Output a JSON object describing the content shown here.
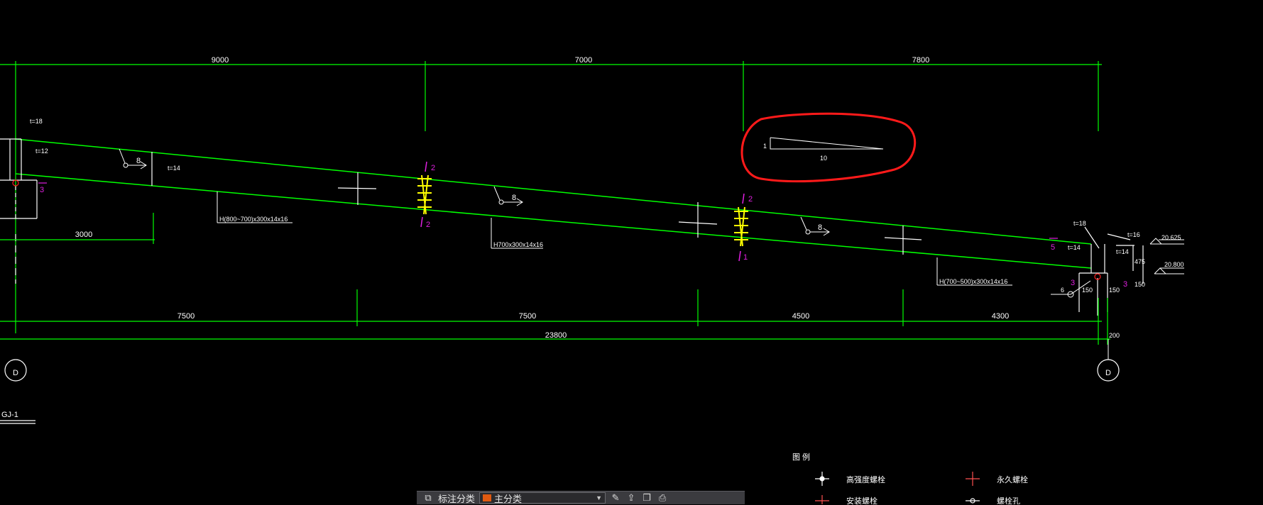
{
  "drawing": {
    "title": "GJ-1",
    "top_dimensions": [
      "9000",
      "7000",
      "7800"
    ],
    "bottom_dimensions": [
      "7500",
      "7500",
      "4500",
      "4300"
    ],
    "overall_dimension": "23800",
    "left_dimension": "3000",
    "right_offset": "200",
    "axis_left": "D",
    "axis_right": "D",
    "beam_labels": [
      "H(800~700)x300x14x16",
      "H700x300x14x16",
      "H(700~500)x300x14x16"
    ],
    "weld_sizes": [
      "8",
      "8",
      "8"
    ],
    "plate_labels": [
      "t=18",
      "t=12",
      "t=14",
      "t=18",
      "t=14",
      "t=16",
      "t=14"
    ],
    "splice_marks": [
      "2",
      "2",
      "2",
      "1"
    ],
    "section_marks": [
      "3",
      "5",
      "3",
      "3"
    ],
    "right_dims": [
      "150",
      "150",
      "475",
      "150"
    ],
    "elevations": [
      "20.625",
      "20.800"
    ],
    "slope_note": {
      "rise": "1",
      "run": "10"
    },
    "bolt_ref": "6"
  },
  "legend": {
    "title": "图 例",
    "items": [
      "高强度螺栓",
      "永久螺栓",
      "安装螺栓",
      "螺栓孔"
    ]
  },
  "toolbar": {
    "label": "标注分类",
    "select_value": "主分类",
    "icons": [
      "layers-icon",
      "edit-icon",
      "upload-icon",
      "copy-icon",
      "print-icon"
    ]
  },
  "colors": {
    "grid": "#00ff00",
    "lines": "#ffffff",
    "bolts": "#ffff00",
    "marks": "#e020e0",
    "annotation": "#ff2020",
    "background": "#000000"
  }
}
